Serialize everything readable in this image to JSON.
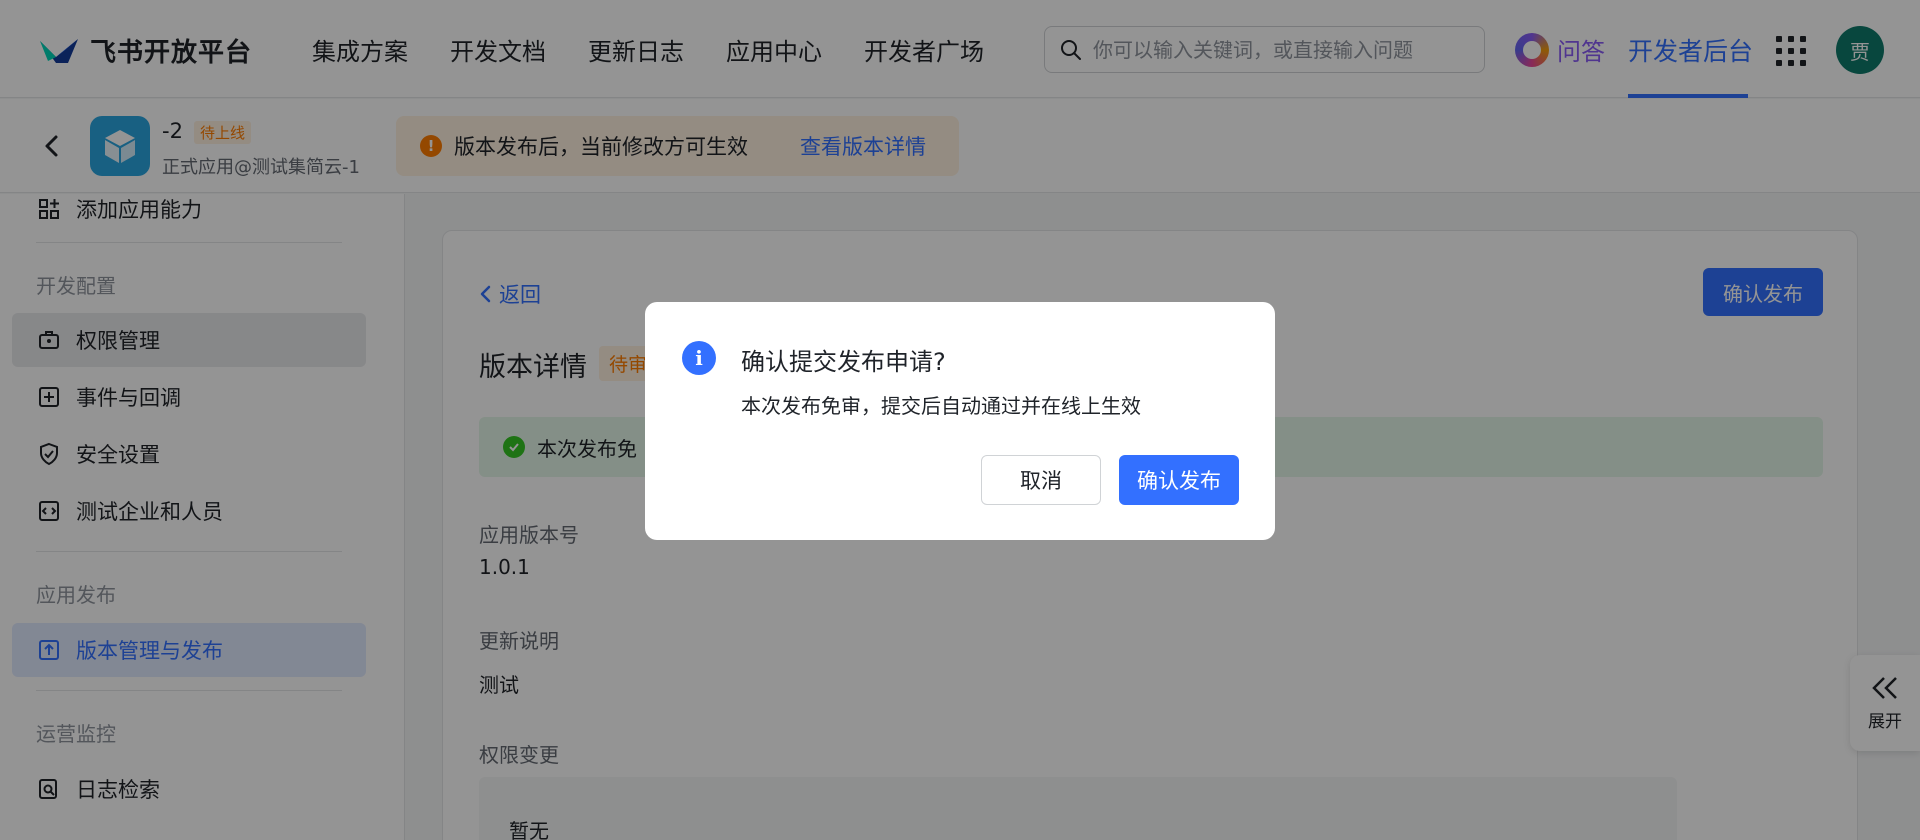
{
  "header": {
    "logo_text": "飞书开放平台",
    "nav": [
      "集成方案",
      "开发文档",
      "更新日志",
      "应用中心",
      "开发者广场"
    ],
    "search_placeholder": "你可以输入关键词，或直接输入问题",
    "qa_label": "问答",
    "dev_console": "开发者后台",
    "avatar_initial": "贾"
  },
  "appbar": {
    "app_name": "-2",
    "status_badge": "待上线",
    "app_sub": "正式应用@测试集简云-1",
    "notice_text": "版本发布后，当前修改方可生效",
    "notice_link": "查看版本详情"
  },
  "sidebar": {
    "item_add_capability": "添加应用能力",
    "section_dev_config": "开发配置",
    "item_permissions": "权限管理",
    "item_events": "事件与回调",
    "item_security": "安全设置",
    "item_test_org": "测试企业和人员",
    "section_app_publish": "应用发布",
    "item_versions": "版本管理与发布",
    "section_ops": "运营监控",
    "item_log_search": "日志检索"
  },
  "main": {
    "back_label": "返回",
    "confirm_publish": "确认发布",
    "title": "版本详情",
    "status_badge": "待审",
    "success_text": "本次发布免",
    "version_label": "应用版本号",
    "version_value": "1.0.1",
    "notes_label": "更新说明",
    "notes_value": "测试",
    "perm_label": "权限变更",
    "perm_value": "暂无"
  },
  "expand_label": "展开",
  "modal": {
    "title": "确认提交发布申请?",
    "body": "本次发布免审，提交后自动通过并在线上生效",
    "cancel": "取消",
    "confirm": "确认发布"
  },
  "colors": {
    "brand_blue": "#3370ff",
    "warning_orange": "#ff7d00",
    "success_green": "#34c724"
  }
}
